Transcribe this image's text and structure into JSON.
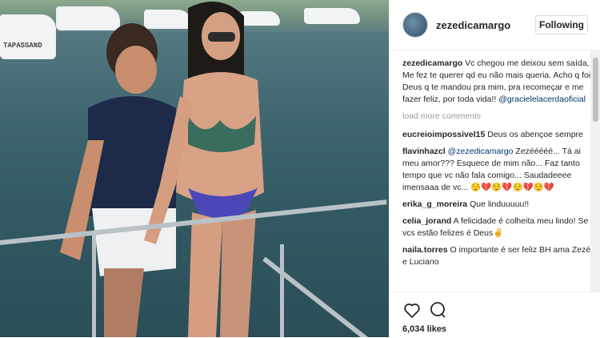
{
  "header": {
    "username": "zezedicamargo",
    "follow_label": "Following"
  },
  "photo": {
    "boat_name": "TAPASSAND"
  },
  "caption": {
    "user": "zezedicamargo",
    "text": "Vc chegou me deixou sem saída, Me fez te querer qd eu não mais queria. Acho q foi Deus q te mandou pra mim, pra recomeçar e me fazer feliz, por toda vida!!",
    "mention": "@gracielelacerdaoficial"
  },
  "load_more_label": "load more comments",
  "comments": [
    {
      "user": "eucreioimpossivel15",
      "text": "Deus os abençoe sempre"
    },
    {
      "user": "flavinhazcl",
      "mention": "@zezedicamargo",
      "text": "Zezééééé... Tá ai meu amor??? Esquece de mim não... Faz tanto tempo que vc não fala comigo... Saudadeeee imensaaa de vc... 😌💔😌💔😌💔😌💔"
    },
    {
      "user": "erika_g_moreira",
      "text": "Que linduuuuu!!"
    },
    {
      "user": "celia_jorand",
      "text": "A felicidade é colheita meu lindo! Se vcs estão felizes é Deus✌"
    },
    {
      "user": "naila.torres",
      "text": "O importante é ser feliz BH ama Zezé e Luciano"
    }
  ],
  "likes_label": "6,034 likes",
  "icons": [
    "heart-icon",
    "comment-icon"
  ],
  "colors": {
    "link": "#003569",
    "muted": "#999999",
    "text": "#262626"
  }
}
